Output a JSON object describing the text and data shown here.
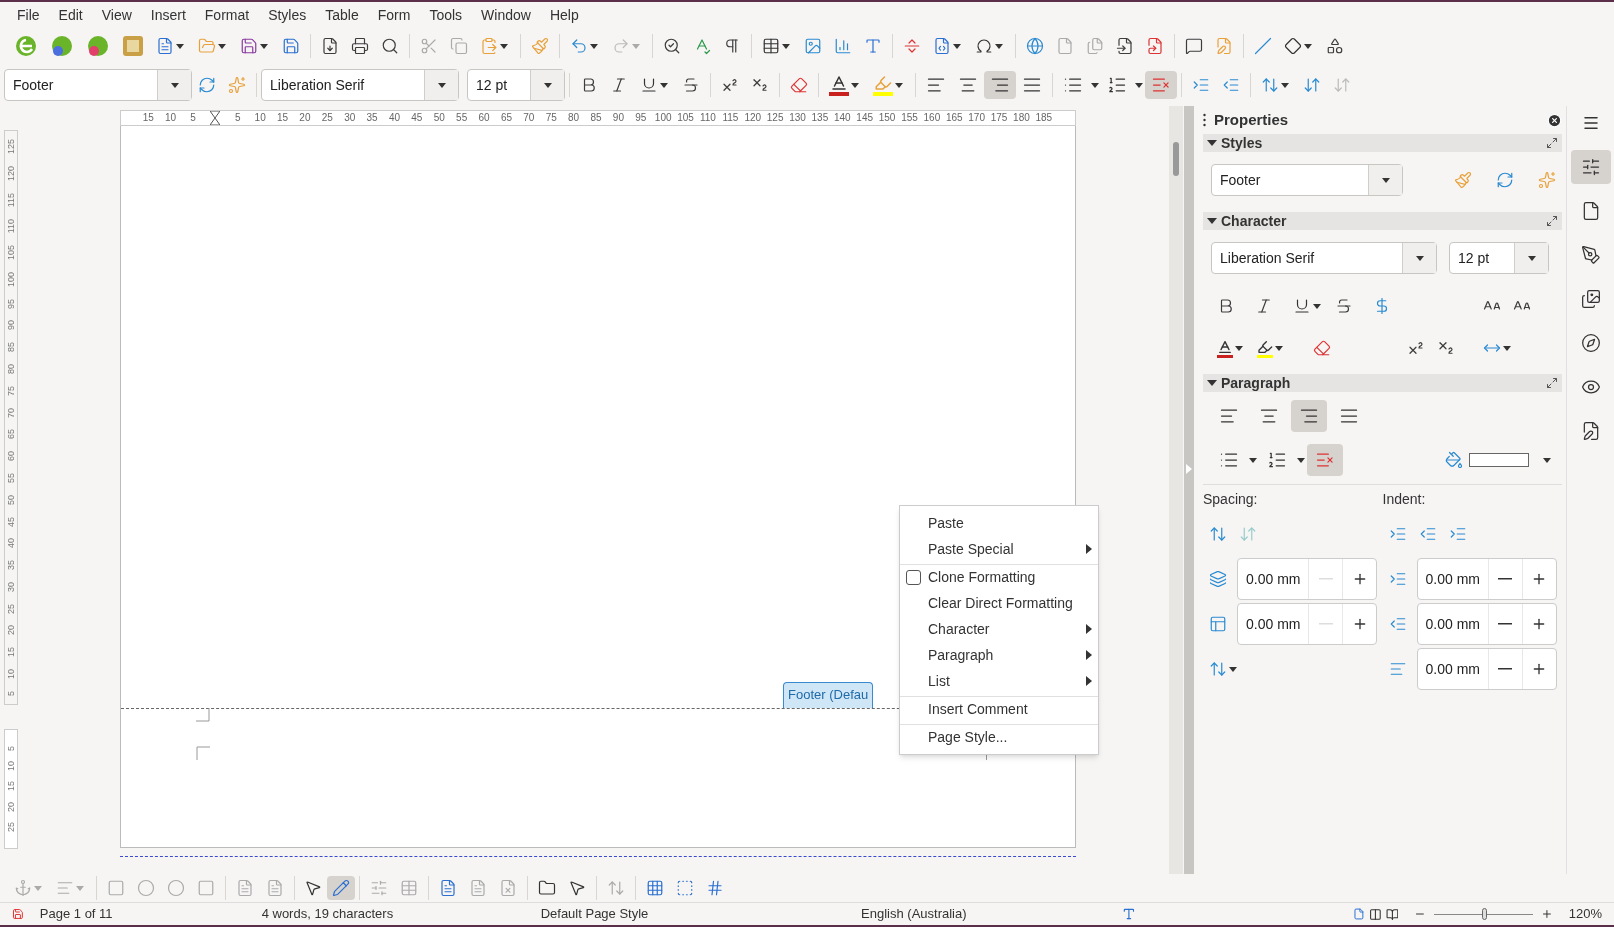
{
  "menu_bar": [
    "File",
    "Edit",
    "View",
    "Insert",
    "Format",
    "Styles",
    "Table",
    "Form",
    "Tools",
    "Window",
    "Help"
  ],
  "formatting_toolbar": {
    "paragraph_style": "Footer",
    "font": "Liberation Serif",
    "size": "12 pt",
    "alignment": [
      {
        "kind": "left",
        "selected": false
      },
      {
        "kind": "center",
        "selected": false
      },
      {
        "kind": "right",
        "selected": true
      },
      {
        "kind": "justify",
        "selected": false
      }
    ],
    "lists": [
      {
        "kind": "unordered",
        "selected": false
      },
      {
        "kind": "ordered",
        "selected": false
      },
      {
        "kind": "none",
        "selected": true
      }
    ]
  },
  "ruler": {
    "labels": [
      "15",
      "10",
      "5",
      "5",
      "10",
      "15",
      "20",
      "25",
      "30",
      "35",
      "40",
      "45",
      "50",
      "55",
      "60",
      "65",
      "70",
      "75",
      "80",
      "85",
      "90",
      "95",
      "100",
      "105",
      "110",
      "115",
      "120",
      "125",
      "130",
      "135",
      "140",
      "145",
      "150",
      "155",
      "160",
      "165",
      "170",
      "175",
      "180",
      "185"
    ]
  },
  "vertical_ruler": {
    "top_labels": [
      "125",
      "120",
      "115",
      "110",
      "105",
      "100",
      "95",
      "90",
      "85",
      "80",
      "75",
      "70",
      "65",
      "60",
      "55",
      "50",
      "45",
      "40",
      "35",
      "30",
      "25",
      "20",
      "15",
      "10",
      "5"
    ],
    "bottom_labels": [
      "5",
      "10",
      "15",
      "20",
      "25"
    ]
  },
  "footer_tab": {
    "label": "Footer (Defau"
  },
  "context_menu": [
    {
      "label": "Paste",
      "kind": "item",
      "submenu": false,
      "separator_before": false
    },
    {
      "label": "Paste Special",
      "kind": "item",
      "submenu": true,
      "separator_before": false
    },
    {
      "label": "Clone Formatting",
      "kind": "checkbox",
      "checked": false,
      "submenu": false,
      "separator_before": true
    },
    {
      "label": "Clear Direct Formatting",
      "kind": "item",
      "submenu": false,
      "separator_before": false
    },
    {
      "label": "Character",
      "kind": "item",
      "submenu": true,
      "separator_before": false
    },
    {
      "label": "Paragraph",
      "kind": "item",
      "submenu": true,
      "separator_before": false
    },
    {
      "label": "List",
      "kind": "item",
      "submenu": true,
      "separator_before": false
    },
    {
      "label": "Insert Comment",
      "kind": "item",
      "submenu": false,
      "separator_before": true
    },
    {
      "label": "Page Style...",
      "kind": "item",
      "submenu": false,
      "separator_before": true
    }
  ],
  "sidebar": {
    "title": "Properties",
    "styles": {
      "title": "Styles",
      "expanded": true,
      "value": "Footer"
    },
    "character": {
      "title": "Character",
      "expanded": true,
      "font": "Liberation Serif",
      "size": "12 pt"
    },
    "paragraph": {
      "title": "Paragraph",
      "expanded": true,
      "alignment": [
        {
          "kind": "left",
          "selected": false
        },
        {
          "kind": "center",
          "selected": false
        },
        {
          "kind": "right",
          "selected": true
        },
        {
          "kind": "justify",
          "selected": false
        }
      ],
      "lists": [
        {
          "kind": "unordered",
          "selected": false
        },
        {
          "kind": "ordered",
          "selected": false
        },
        {
          "kind": "none",
          "selected": true
        }
      ],
      "spacing_label": "Spacing:",
      "indent_label": "Indent:",
      "spacing_fields": [
        {
          "value": "0.00 mm",
          "decrement_disabled": true
        },
        {
          "value": "0.00 mm",
          "decrement_disabled": true
        }
      ],
      "indent_fields": [
        {
          "value": "0.00 mm",
          "decrement_disabled": false
        },
        {
          "value": "0.00 mm",
          "decrement_disabled": false
        },
        {
          "value": "0.00 mm",
          "decrement_disabled": false
        }
      ]
    },
    "tabs": [
      {
        "kind": "properties",
        "selected": true
      },
      {
        "kind": "page",
        "selected": false
      },
      {
        "kind": "styles",
        "selected": false
      },
      {
        "kind": "gallery",
        "selected": false
      },
      {
        "kind": "navigator",
        "selected": false
      },
      {
        "kind": "inspector",
        "selected": false
      },
      {
        "kind": "changes",
        "selected": false
      }
    ]
  },
  "frame_toolbar": [
    {
      "kind": "select",
      "selected": false
    },
    {
      "kind": "edit-points",
      "selected": true
    }
  ],
  "status_bar": {
    "page": "Page 1 of 11",
    "words": "4 words, 19 characters",
    "page_style": "Default Page Style",
    "language": "English (Australia)",
    "zoom": "120%",
    "zoom_level": {
      "level": 0.5
    }
  }
}
